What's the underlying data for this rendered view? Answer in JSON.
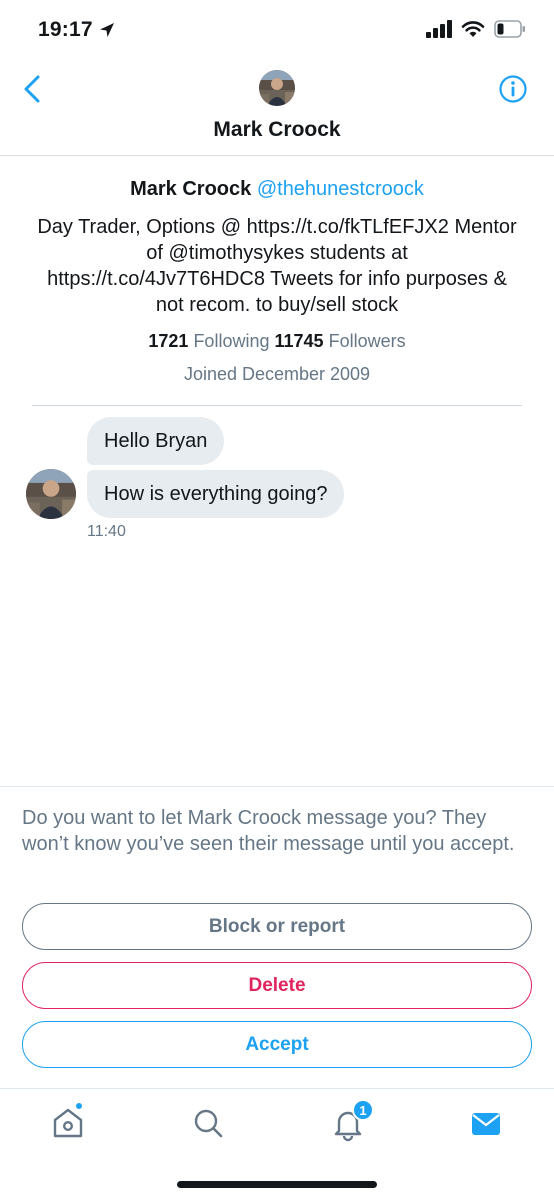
{
  "status_bar": {
    "time": "19:17"
  },
  "header": {
    "title": "Mark Croock"
  },
  "profile": {
    "name": "Mark Croock",
    "handle": "@thehunestcroock",
    "bio": "Day Trader, Options @ https://t.co/fkTLfEFJX2 Mentor of @timothysykes students at https://t.co/4Jv7T6HDC8 Tweets for info purposes & not recom. to buy/sell stock",
    "following_count": "1721",
    "following_label": "Following",
    "followers_count": "11745",
    "followers_label": "Followers",
    "joined": "Joined December 2009"
  },
  "messages": [
    {
      "text": "Hello Bryan"
    },
    {
      "text": "How is everything going?"
    }
  ],
  "message_time": "11:40",
  "request": {
    "prompt": "Do you want to let Mark Croock message you? They won’t know you’ve seen their message until you accept.",
    "block_label": "Block or report",
    "delete_label": "Delete",
    "accept_label": "Accept"
  },
  "tab_bar": {
    "notifications_badge": "1"
  },
  "colors": {
    "accent": "#1da1f2",
    "danger": "#e0245e",
    "muted": "#657786",
    "bubble": "#e6ecf0"
  },
  "icons": [
    "location-arrow-icon",
    "cellular-signal-icon",
    "wifi-icon",
    "battery-icon",
    "back-chevron-icon",
    "info-icon",
    "home-icon",
    "search-icon",
    "bell-icon",
    "mail-icon"
  ]
}
